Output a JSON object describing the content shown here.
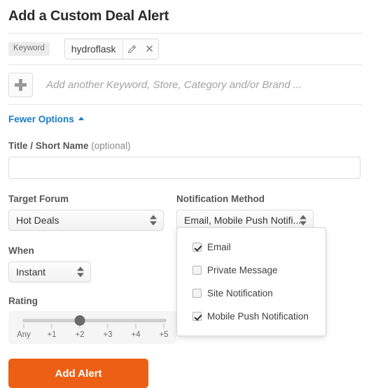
{
  "header": {
    "title": "Add a Custom Deal Alert"
  },
  "keyword_row": {
    "badge_label": "Keyword",
    "chip_text": "hydroflask",
    "edit_icon": "pencil-icon",
    "remove_icon": "close-icon"
  },
  "add_row": {
    "plus_icon": "plus-icon",
    "placeholder": "Add another Keyword, Store, Category and/or Brand ..."
  },
  "options_toggle": {
    "label": "Fewer Options",
    "chevron_icon": "chevron-up-icon"
  },
  "title_field": {
    "label": "Title / Short Name",
    "optional_suffix": "(optional)",
    "value": "",
    "placeholder": ""
  },
  "target_forum": {
    "label": "Target Forum",
    "value": "Hot Deals"
  },
  "notification_method": {
    "label": "Notification Method",
    "value": "Email, Mobile Push Notifi...",
    "options": [
      {
        "label": "Email",
        "checked": true
      },
      {
        "label": "Private Message",
        "checked": false
      },
      {
        "label": "Site Notification",
        "checked": false
      },
      {
        "label": "Mobile Push Notification",
        "checked": true
      }
    ]
  },
  "when": {
    "label": "When",
    "value": "Instant"
  },
  "rating": {
    "label": "Rating",
    "ticks": [
      "Any",
      "+1",
      "+2",
      "+3",
      "+4",
      "+5"
    ],
    "selected": "+2",
    "selected_index": 2
  },
  "submit": {
    "label": "Add Alert"
  },
  "colors": {
    "accent_orange": "#ec5f14",
    "link_blue": "#1a7bc9",
    "label_gray": "#565656",
    "border_gray": "#dcdcdc"
  }
}
